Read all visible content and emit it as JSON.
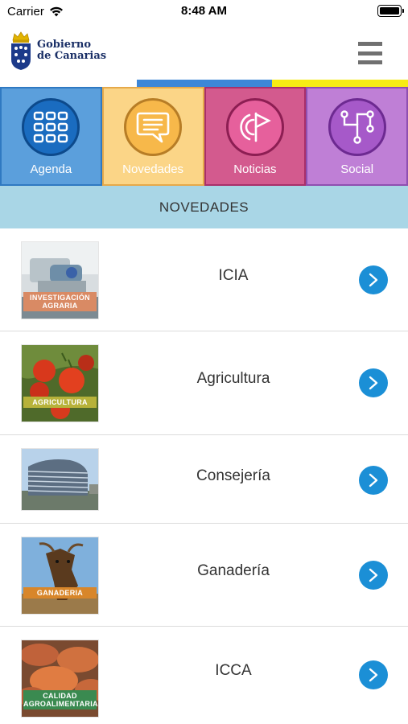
{
  "status_bar": {
    "carrier": "Carrier",
    "time": "8:48 AM"
  },
  "header": {
    "logo_line1": "Gobierno",
    "logo_line2": "de Canarias",
    "menu_icon": "hamburger-menu-icon"
  },
  "colors": {
    "blue_bar": "#3d87d8",
    "yellow_bar": "#f7ec14",
    "chevron": "#1b8fd6",
    "section_bg": "#a9d6e6"
  },
  "tiles": [
    {
      "label": "Agenda",
      "icon": "calendar-grid-icon"
    },
    {
      "label": "Novedades",
      "icon": "speech-bubble-icon"
    },
    {
      "label": "Noticias",
      "icon": "broadcast-flag-icon"
    },
    {
      "label": "Social",
      "icon": "network-nodes-icon"
    }
  ],
  "section_title": "NOVEDADES",
  "items": [
    {
      "title": "ICIA",
      "image_caption": "INVESTIGACIÓN AGRARIA"
    },
    {
      "title": "Agricultura",
      "image_caption": "AGRICULTURA"
    },
    {
      "title": "Consejería",
      "image_caption": ""
    },
    {
      "title": "Ganadería",
      "image_caption": "GANADERIA"
    },
    {
      "title": "ICCA",
      "image_caption": "CALIDAD AGROALIMENTARIA"
    }
  ]
}
